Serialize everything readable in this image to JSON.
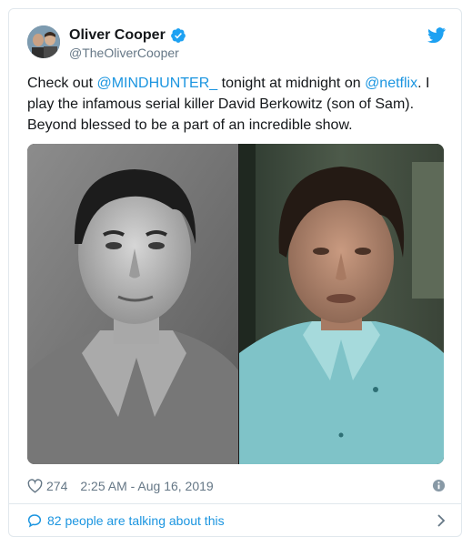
{
  "tweet": {
    "author": {
      "name": "Oliver Cooper",
      "handle": "@TheOliverCooper",
      "verified": true
    },
    "text": {
      "part1": "Check out ",
      "mention1": "@MINDHUNTER_",
      "part2": " tonight at midnight on ",
      "mention2": "@netflix",
      "part3": ". I play the infamous serial killer David Berkowitz (son of Sam). Beyond blessed to be a part of an incredible show."
    },
    "media": {
      "left_image": "black-and-white portrait photo",
      "right_image": "color still of actor in light blue shirt"
    },
    "stats": {
      "likes": "274",
      "timestamp": "2:25 AM - Aug 16, 2019"
    },
    "footer": {
      "talking": "82 people are talking about this"
    }
  },
  "colors": {
    "link": "#1b95e0",
    "muted": "#657786",
    "text": "#14171a",
    "border": "#e1e8ed"
  },
  "icons": [
    "verified-badge-icon",
    "twitter-bird-icon",
    "heart-icon",
    "info-icon",
    "speech-bubble-icon",
    "chevron-right-icon"
  ]
}
